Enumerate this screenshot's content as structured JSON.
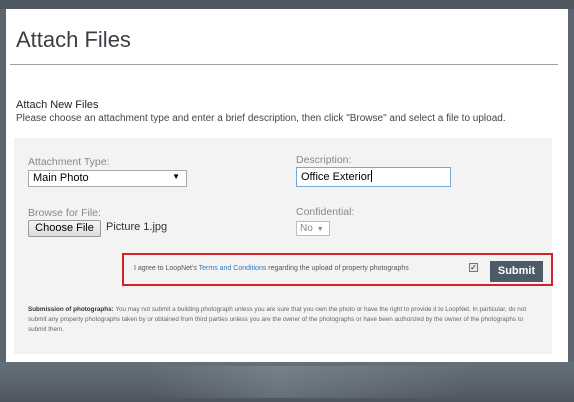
{
  "page": {
    "title": "Attach Files"
  },
  "section": {
    "heading": "Attach New Files",
    "description": "Please choose an attachment type and enter a brief description, then click \"Browse\" and select a file to upload."
  },
  "form": {
    "attachment_type": {
      "label": "Attachment Type:",
      "value": "Main Photo"
    },
    "description": {
      "label": "Description:",
      "value": "Office Exterior"
    },
    "browse": {
      "label": "Browse for File:",
      "button": "Choose File",
      "file_name": "Picture 1.jpg"
    },
    "confidential": {
      "label": "Confidential:",
      "value": "No"
    },
    "agreement": {
      "text_before": "I agree to LoopNet's ",
      "link": "Terms and Conditions",
      "text_after": " regarding the upload of property photographs",
      "checked": true
    },
    "submit_label": "Submit"
  },
  "notice": {
    "heading": "Submission of photographs:",
    "body": " You may not submit a building photograph unless you are sure that you own the photo or have the right to provide it to LoopNet. In particular, do not submit any property photographs taken by or obtained from third parties unless you are the owner of the photographs or have been authorized by the owner of the photographs to submit them."
  },
  "colors": {
    "accent_red": "#d2232a",
    "submit_bg": "#4e5b67",
    "link": "#2e7bbf"
  }
}
